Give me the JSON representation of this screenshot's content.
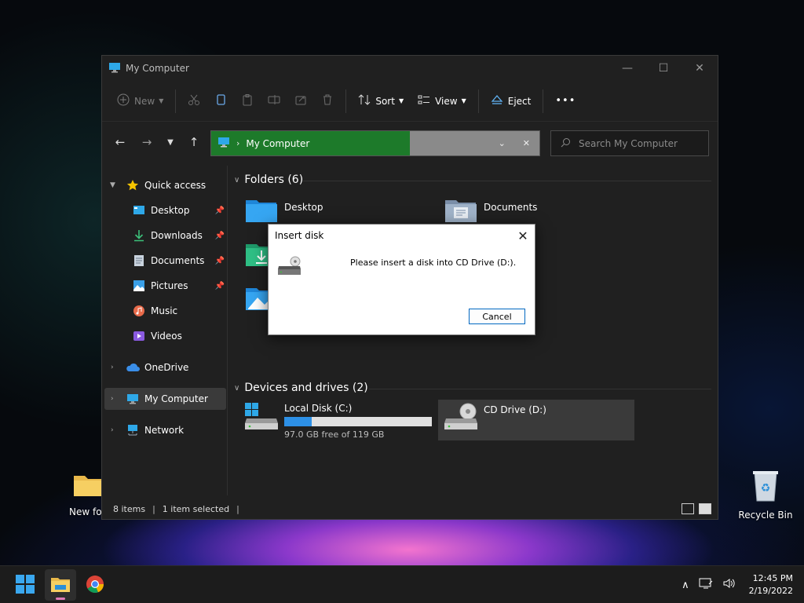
{
  "desktop": {
    "new_folder_label": "New fol",
    "recycle_bin_label": "Recycle Bin"
  },
  "window": {
    "title": "My Computer",
    "minimize": "—",
    "maximize": "☐",
    "close": "✕"
  },
  "toolbar": {
    "new_label": "New",
    "sort_label": "Sort",
    "view_label": "View",
    "eject_label": "Eject",
    "more_label": "•••"
  },
  "address": {
    "crumb": "My Computer"
  },
  "search": {
    "placeholder": "Search My Computer"
  },
  "sidebar": {
    "quick_access": "Quick access",
    "items": [
      {
        "label": "Desktop"
      },
      {
        "label": "Downloads"
      },
      {
        "label": "Documents"
      },
      {
        "label": "Pictures"
      },
      {
        "label": "Music"
      },
      {
        "label": "Videos"
      }
    ],
    "onedrive": "OneDrive",
    "my_computer": "My Computer",
    "network": "Network"
  },
  "content": {
    "folders_header": "Folders (6)",
    "folders": [
      {
        "name": "Desktop"
      },
      {
        "name": "Documents"
      }
    ],
    "devices_header": "Devices and drives (2)",
    "drives": [
      {
        "name": "Local Disk (C:)",
        "free_text": "97.0 GB free of 119 GB",
        "used_fraction": 0.185
      },
      {
        "name": "CD Drive (D:)"
      }
    ]
  },
  "status": {
    "items": "8 items",
    "selected": "1 item selected"
  },
  "dialog": {
    "title": "Insert disk",
    "message": "Please insert a disk into CD Drive (D:).",
    "cancel_label": "Cancel",
    "close": "✕"
  },
  "taskbar": {
    "time": "12:45 PM",
    "date": "2/19/2022"
  },
  "colors": {
    "address_highlight": "#1d7a2a",
    "drive_bar": "#2d90e6",
    "accent": "#0067c0"
  }
}
